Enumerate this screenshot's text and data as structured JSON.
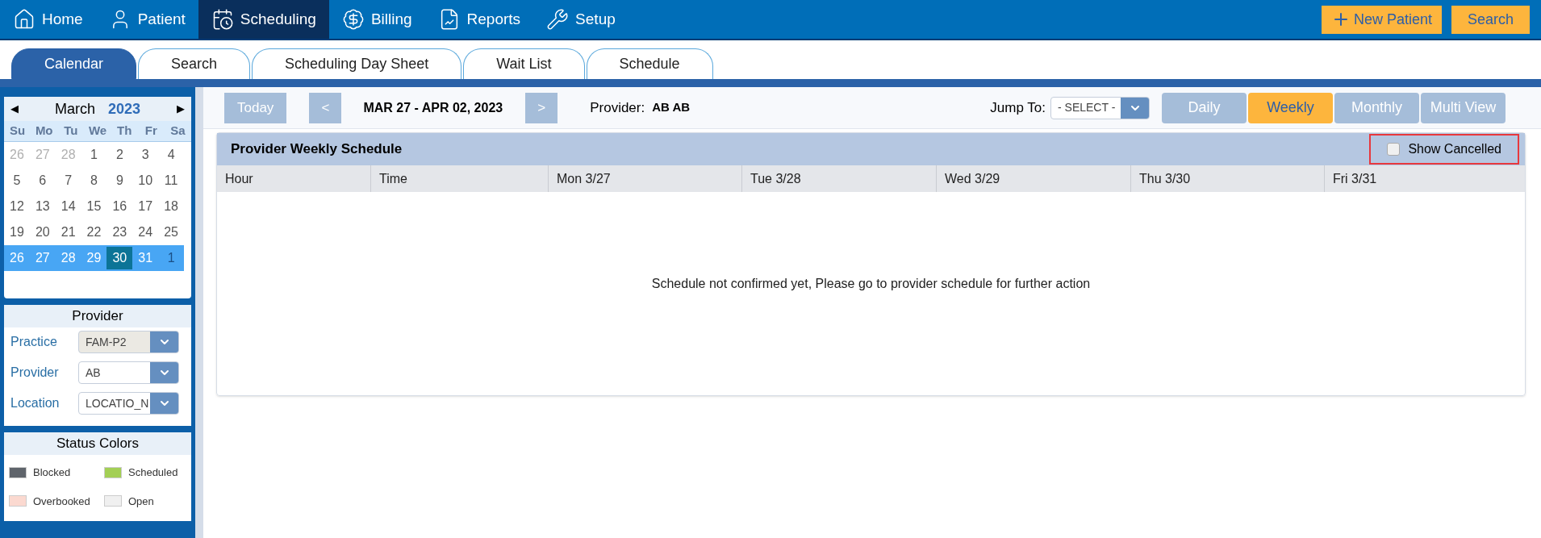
{
  "nav": {
    "items": [
      {
        "label": "Home",
        "selected": false
      },
      {
        "label": "Patient",
        "selected": false
      },
      {
        "label": "Scheduling",
        "selected": true
      },
      {
        "label": "Billing",
        "selected": false
      },
      {
        "label": "Reports",
        "selected": false
      },
      {
        "label": "Setup",
        "selected": false
      }
    ],
    "new_patient": "New Patient",
    "search": "Search"
  },
  "tabs": [
    {
      "label": "Calendar",
      "selected": true
    },
    {
      "label": "Search",
      "selected": false
    },
    {
      "label": "Scheduling Day Sheet",
      "selected": false
    },
    {
      "label": "Wait List",
      "selected": false
    },
    {
      "label": "Schedule",
      "selected": false
    }
  ],
  "mini_calendar": {
    "month": "March",
    "year": "2023",
    "prev": "◀",
    "next": "▶",
    "weekdays": [
      "Su",
      "Mo",
      "Tu",
      "We",
      "Th",
      "Fr",
      "Sa"
    ],
    "weeks": [
      {
        "selected": false,
        "days": [
          {
            "label": "26",
            "muted": true,
            "current": false
          },
          {
            "label": "27",
            "muted": true,
            "current": false
          },
          {
            "label": "28",
            "muted": true,
            "current": false
          },
          {
            "label": "1",
            "muted": false,
            "current": false
          },
          {
            "label": "2",
            "muted": false,
            "current": false
          },
          {
            "label": "3",
            "muted": false,
            "current": false
          },
          {
            "label": "4",
            "muted": false,
            "current": false
          }
        ]
      },
      {
        "selected": false,
        "days": [
          {
            "label": "5",
            "muted": false,
            "current": false
          },
          {
            "label": "6",
            "muted": false,
            "current": false
          },
          {
            "label": "7",
            "muted": false,
            "current": false
          },
          {
            "label": "8",
            "muted": false,
            "current": false
          },
          {
            "label": "9",
            "muted": false,
            "current": false
          },
          {
            "label": "10",
            "muted": false,
            "current": false
          },
          {
            "label": "11",
            "muted": false,
            "current": false
          }
        ]
      },
      {
        "selected": false,
        "days": [
          {
            "label": "12",
            "muted": false,
            "current": false
          },
          {
            "label": "13",
            "muted": false,
            "current": false
          },
          {
            "label": "14",
            "muted": false,
            "current": false
          },
          {
            "label": "15",
            "muted": false,
            "current": false
          },
          {
            "label": "16",
            "muted": false,
            "current": false
          },
          {
            "label": "17",
            "muted": false,
            "current": false
          },
          {
            "label": "18",
            "muted": false,
            "current": false
          }
        ]
      },
      {
        "selected": false,
        "days": [
          {
            "label": "19",
            "muted": false,
            "current": false
          },
          {
            "label": "20",
            "muted": false,
            "current": false
          },
          {
            "label": "21",
            "muted": false,
            "current": false
          },
          {
            "label": "22",
            "muted": false,
            "current": false
          },
          {
            "label": "23",
            "muted": false,
            "current": false
          },
          {
            "label": "24",
            "muted": false,
            "current": false
          },
          {
            "label": "25",
            "muted": false,
            "current": false
          }
        ]
      },
      {
        "selected": true,
        "days": [
          {
            "label": "26",
            "muted": false,
            "current": false
          },
          {
            "label": "27",
            "muted": false,
            "current": false
          },
          {
            "label": "28",
            "muted": false,
            "current": false
          },
          {
            "label": "29",
            "muted": false,
            "current": false
          },
          {
            "label": "30",
            "muted": false,
            "current": true
          },
          {
            "label": "31",
            "muted": false,
            "current": false
          },
          {
            "label": "1",
            "muted": true,
            "current": false
          }
        ]
      }
    ]
  },
  "provider_panel": {
    "title": "Provider",
    "fields": [
      {
        "label": "Practice",
        "value": "FAM-P2",
        "disabled": true
      },
      {
        "label": "Provider",
        "value": "AB",
        "disabled": false
      },
      {
        "label": "Location",
        "value": "LOCATIO_N",
        "disabled": false
      }
    ]
  },
  "status_colors": {
    "title": "Status Colors",
    "items": [
      {
        "label": "Blocked",
        "color": "#5f646b"
      },
      {
        "label": "Scheduled",
        "color": "#a3cf55"
      },
      {
        "label": "Overbooked",
        "color": "#fbd9d0"
      },
      {
        "label": "Open",
        "color": "#f0f0f0"
      }
    ]
  },
  "toolbar": {
    "today": "Today",
    "prev": "<",
    "range": "MAR 27 - APR 02, 2023",
    "next": ">",
    "provider_label": "Provider:",
    "provider_value": "AB AB",
    "jump_label": "Jump To:",
    "jump_value": "- SELECT -",
    "views": [
      {
        "label": "Daily",
        "selected": false
      },
      {
        "label": "Weekly",
        "selected": true
      },
      {
        "label": "Monthly",
        "selected": false
      },
      {
        "label": "Multi View",
        "selected": false
      }
    ]
  },
  "schedule": {
    "title": "Provider Weekly Schedule",
    "show_cancelled": {
      "label": "Show Cancelled",
      "checked": false
    },
    "columns": [
      "Hour",
      "Time",
      "Mon 3/27",
      "Tue 3/28",
      "Wed 3/29",
      "Thu 3/30",
      "Fri 3/31"
    ],
    "message": "Schedule not confirmed yet, Please go to provider schedule for further action"
  }
}
